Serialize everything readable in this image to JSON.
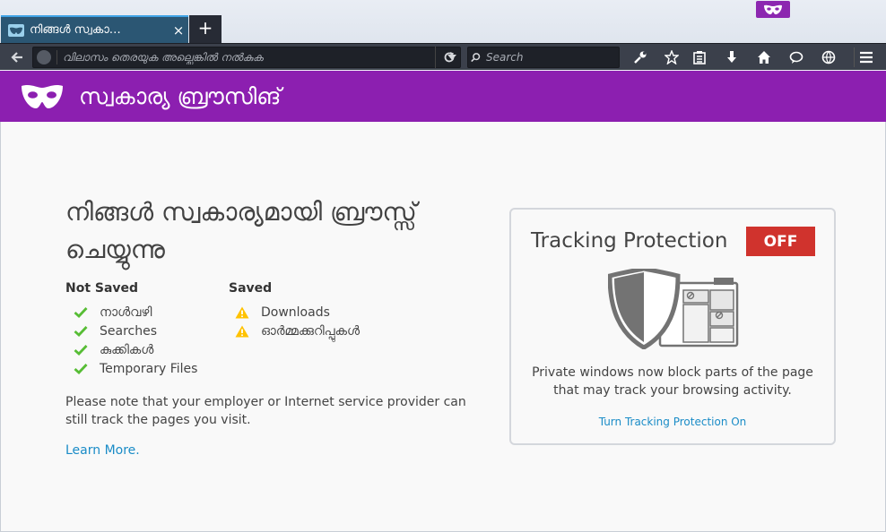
{
  "window": {
    "tab_title": "നിങ്ങൾ സ്വകാ…",
    "close_label": "×",
    "new_tab_label": "+"
  },
  "toolbar": {
    "url_placeholder": "വിലാസം തെരയുക അല്ലെങ്കിൽ നൽകുക",
    "search_placeholder": "Search"
  },
  "header": {
    "title": "സ്വകാര്യ ബ്രൗസിങ്"
  },
  "main": {
    "title": "നിങ്ങൾ സ്വകാര്യമായി ബ്രൗസ്സ് ചെയ്യുന്നു",
    "not_saved": {
      "heading": "Not Saved",
      "items": [
        "നാൾവഴി",
        "Searches",
        "കുക്കികൾ",
        "Temporary Files"
      ]
    },
    "saved": {
      "heading": "Saved",
      "items": [
        "Downloads",
        "ഓർമ്മക്കുറിപ്പുകൾ"
      ]
    },
    "note": "Please note that your employer or Internet service provider can still track the pages you visit.",
    "learn_more": "Learn More."
  },
  "tracking": {
    "title": "Tracking Protection",
    "toggle": "OFF",
    "description": "Private windows now block parts of the page that may track your browsing activity.",
    "link": "Turn Tracking Protection On"
  },
  "colors": {
    "private_purple": "#8c1fb0",
    "off_red": "#d0332d",
    "link_blue": "#1a8cc7",
    "check_green": "#57bd35",
    "warn_yellow": "#ffc200"
  }
}
